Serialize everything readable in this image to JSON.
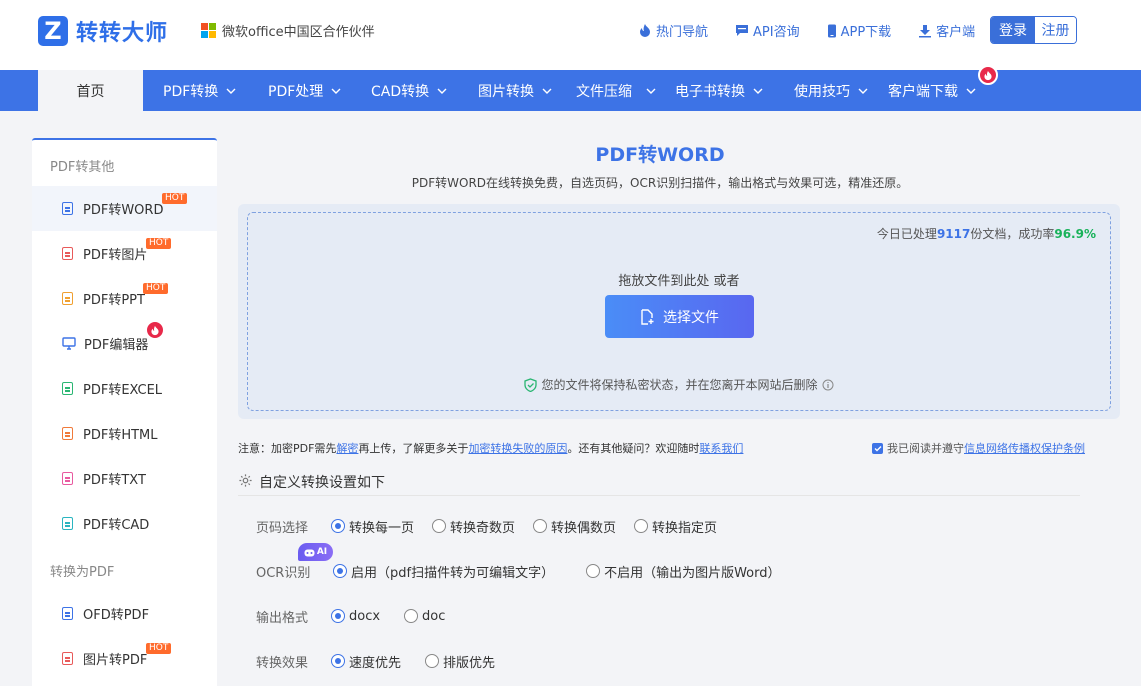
{
  "header": {
    "logo_char": "Z",
    "brand": "转转大师",
    "partner": "微软office中国区合作伙伴",
    "links": [
      {
        "label": "热门导航",
        "icon": "fire-icon"
      },
      {
        "label": "API咨询",
        "icon": "chat-icon"
      },
      {
        "label": "APP下载",
        "icon": "phone-icon"
      },
      {
        "label": "客户端",
        "icon": "download-icon"
      }
    ],
    "login": "登录",
    "register": "注册"
  },
  "nav": {
    "home": "首页",
    "items": [
      "PDF转换",
      "PDF处理",
      "CAD转换",
      "图片转换",
      "文件压缩",
      "电子书转换",
      "使用技巧",
      "客户端下载"
    ]
  },
  "sidebar": {
    "group1": "PDF转其他",
    "items1": [
      {
        "label": "PDF转WORD",
        "badge": "HOT",
        "color": "#3d73e6"
      },
      {
        "label": "PDF转图片",
        "badge": "HOT",
        "color": "#e85a5a"
      },
      {
        "label": "PDF转PPT",
        "badge": "HOT",
        "color": "#f0a030"
      },
      {
        "label": "PDF编辑器",
        "badge": "",
        "color": "#3d73e6"
      },
      {
        "label": "PDF转EXCEL",
        "badge": "",
        "color": "#2bb673"
      },
      {
        "label": "PDF转HTML",
        "badge": "",
        "color": "#f07a3a"
      },
      {
        "label": "PDF转TXT",
        "badge": "",
        "color": "#e85aa0"
      },
      {
        "label": "PDF转CAD",
        "badge": "",
        "color": "#2ab5c0"
      }
    ],
    "group2": "转换为PDF",
    "items2": [
      {
        "label": "OFD转PDF",
        "badge": "",
        "color": "#3d73e6"
      },
      {
        "label": "图片转PDF",
        "badge": "HOT",
        "color": "#e85a5a"
      }
    ]
  },
  "main": {
    "title": "PDF转WORD",
    "subtitle": "PDF转WORD在线转换免费，自选页码，OCR识别扫描件，输出格式与效果可选，精准还原。",
    "stats_prefix": "今日已处理",
    "stats_count": "9117",
    "stats_mid": "份文档，成功率",
    "stats_rate": "96.9%",
    "drop_text": "拖放文件到此处 或者",
    "choose_button": "选择文件",
    "privacy_text": "您的文件将保持私密状态，并在您离开本网站后删除"
  },
  "notice": {
    "t1": "注意：加密PDF需先",
    "l1": "解密",
    "t2": "再上传，了解更多关于",
    "l2": "加密转换失败的原因",
    "t3": "。还有其他疑问？欢迎随时",
    "l3": "联系我们",
    "agree_text": "我已阅读并遵守",
    "agree_link": "信息网络传播权保护条例"
  },
  "settings": {
    "title": "自定义转换设置如下",
    "ai_badge": "AI",
    "rows": [
      {
        "label": "页码选择",
        "options": [
          "转换每一页",
          "转换奇数页",
          "转换偶数页",
          "转换指定页"
        ],
        "selected": 0
      },
      {
        "label": "OCR识别",
        "options": [
          "启用（pdf扫描件转为可编辑文字）",
          "不启用（输出为图片版Word）"
        ],
        "selected": 0
      },
      {
        "label": "输出格式",
        "options": [
          "docx",
          "doc"
        ],
        "selected": 0
      },
      {
        "label": "转换效果",
        "options": [
          "速度优先",
          "排版优先"
        ],
        "selected": 0
      }
    ]
  }
}
